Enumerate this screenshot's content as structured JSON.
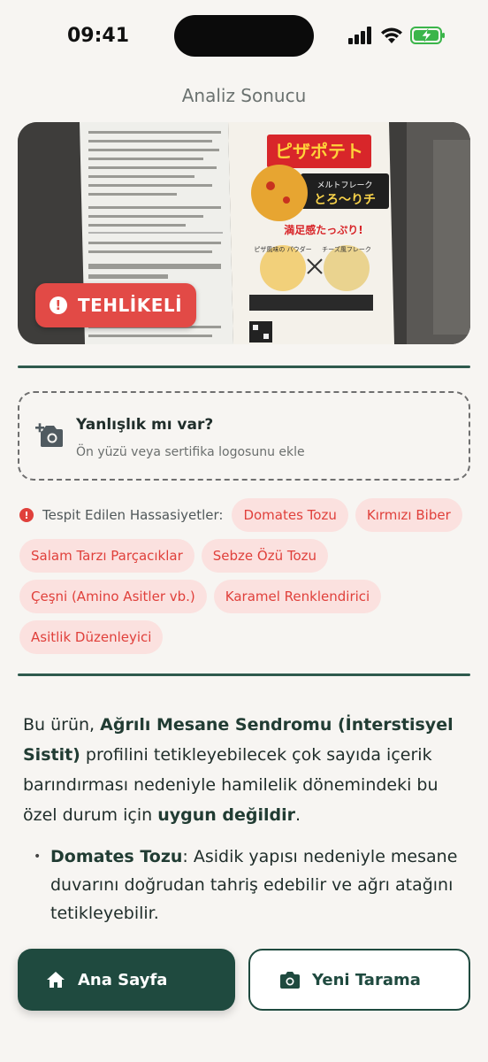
{
  "status_bar": {
    "time": "09:41"
  },
  "header": {
    "title": "Analiz Sonucu"
  },
  "product": {
    "badge_label": "TEHLİKELİ",
    "badge_color": "#e24a46",
    "package_logo": "ピザポテト",
    "package_line1": "メルトフレーク",
    "package_line2": "とろ〜りチ",
    "package_tagline": "満足感たっぷり!",
    "package_item1": "ピザ風味の パウダー",
    "package_item2": "チーズ風フレーク"
  },
  "correction": {
    "title": "Yanlışlık mı var?",
    "subtitle": "Ön yüzü veya sertifika logosunu ekle",
    "icon": "camera-plus-icon"
  },
  "sensitivities": {
    "label": "Tespit Edilen Hassasiyetler:",
    "icon": "alert-icon",
    "items": [
      "Domates Tozu",
      "Kırmızı Biber",
      "Salam Tarzı Parçacıklar",
      "Sebze Özü Tozu",
      "Çeşni (Amino Asitler vb.)",
      "Karamel Renklendirici",
      "Asitlik Düzenleyici"
    ]
  },
  "description": {
    "p1_a": "Bu ürün, ",
    "p1_b": "Ağrılı Mesane Sendromu (İnterstisyel Sistit)",
    "p1_c": " profilini tetikleyebilecek çok sayıda içerik barındırması nedeniyle hamilelik dönemindeki bu özel durum için ",
    "p1_d": "uygun değildir",
    "p1_e": ".",
    "bullet_title": "Domates Tozu",
    "bullet_text": ": Asidik yapısı nedeniyle mesane duvarını doğrudan tahriş edebilir ve ağrı atağını tetikleyebilir."
  },
  "actions": {
    "home_label": "Ana Sayfa",
    "scan_label": "Yeni Tarama"
  },
  "colors": {
    "primary": "#1f4a3f",
    "danger": "#e24a46",
    "chip_bg": "#fbe1df",
    "background": "#f7f5f2"
  }
}
